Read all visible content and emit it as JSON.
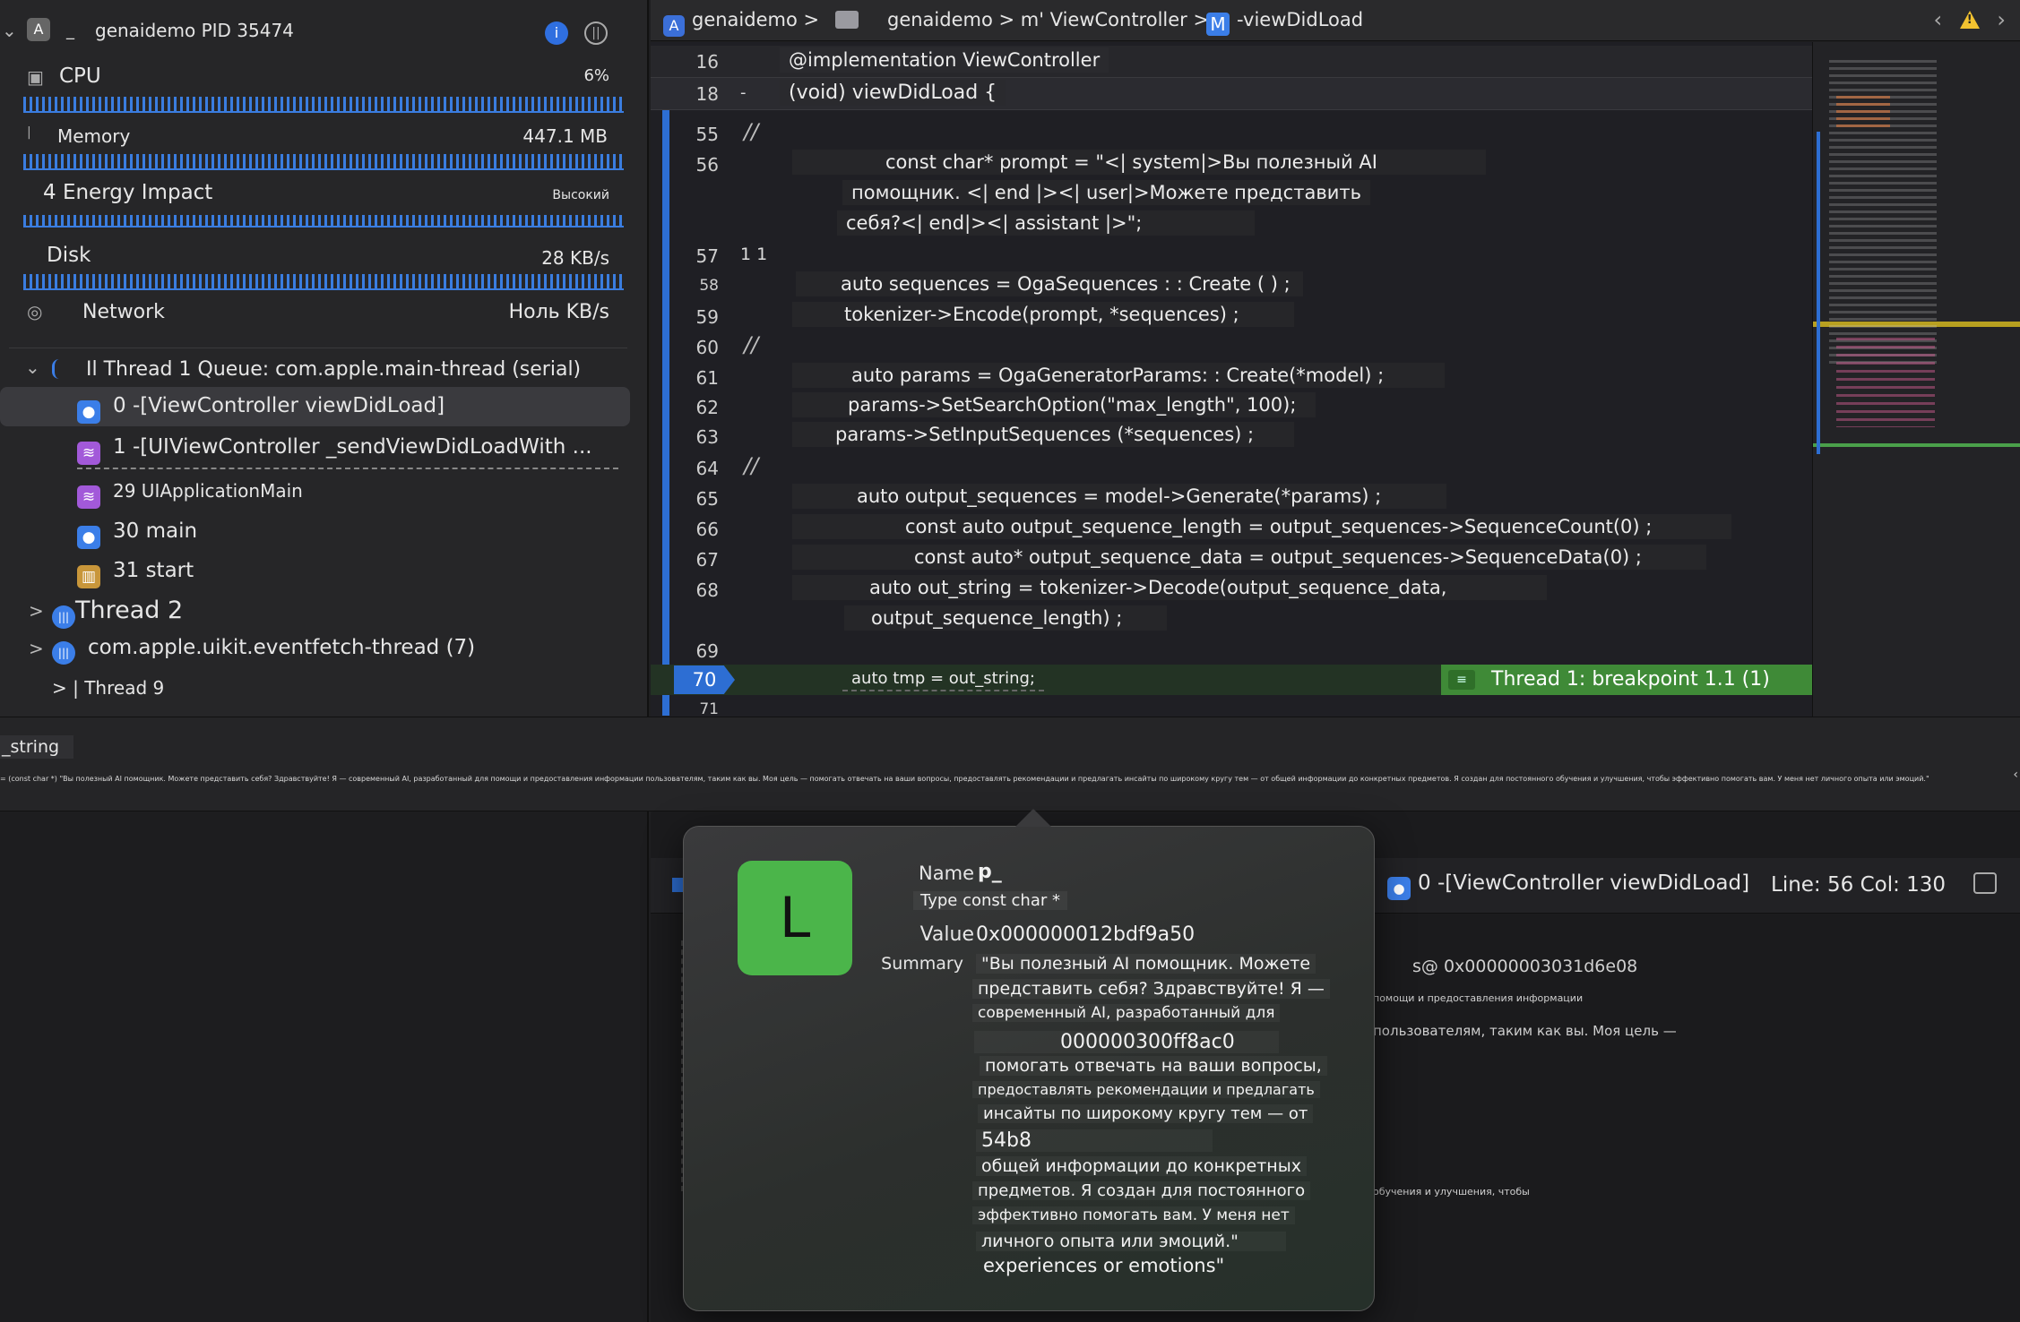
{
  "process": {
    "name": "genaidemo PID 35474"
  },
  "gauges": [
    {
      "label": "CPU",
      "value": "6%"
    },
    {
      "label": "Memory",
      "value": "447.1 MB"
    },
    {
      "label": "4 Energy Impact",
      "value": "Высокий"
    },
    {
      "label": "Disk",
      "value": "28 KB/s"
    },
    {
      "label": "Network",
      "value": "Ноль KB/s"
    }
  ],
  "threads": {
    "thread1": "Il Thread 1 Queue: com.apple.main-thread (serial)",
    "frames": [
      {
        "label": "0 -[ViewController viewDidLoad]"
      },
      {
        "label": "1 -[UIViewController _sendViewDidLoadWith ..."
      },
      {
        "label": "29 UIApplicationMain"
      },
      {
        "label": "30 main"
      },
      {
        "label": "31 start"
      }
    ],
    "thread2": "Thread 2",
    "eventfetch": "com.apple.uikit.eventfetch-thread (7)",
    "thread9": "> | Thread 9"
  },
  "jumpbar": {
    "crumb1": "genaidemo >",
    "crumb2": "genaidemo > m' ViewController >",
    "crumb3": "-viewDidLoad",
    "m_icon": "M"
  },
  "editor": {
    "sticky1": {
      "line": "16",
      "code": "@implementation ViewController"
    },
    "sticky2": {
      "line": "18",
      "marker": "-",
      "code": "(void) viewDidLoad {"
    },
    "lines": [
      {
        "no": "55",
        "comment": "//"
      },
      {
        "no": "56",
        "code": [
          "const char* prompt = \"<| system|>Вы полезный AI",
          "помощник. <| end |><| user|>Можете представить",
          "себя?<| end|><| assistant |>\";"
        ]
      },
      {
        "no": "57",
        "extra": "1 1"
      },
      {
        "no": "58",
        "code": [
          "auto sequences = OgaSequences : : Create ( ) ;"
        ]
      },
      {
        "no": "59",
        "code": [
          "tokenizer->Encode(prompt, *sequences) ;"
        ]
      },
      {
        "no": "60",
        "comment": "//"
      },
      {
        "no": "61",
        "code": [
          "auto params = OgaGeneratorParams: : Create(*model) ;"
        ]
      },
      {
        "no": "62",
        "code": [
          "params->SetSearchOption(\"max_length\", 100);"
        ]
      },
      {
        "no": "63",
        "code": [
          "params->SetInputSequences (*sequences) ;"
        ]
      },
      {
        "no": "64",
        "comment": "//"
      },
      {
        "no": "65",
        "code": [
          "auto output_sequences = model->Generate(*params) ;"
        ]
      },
      {
        "no": "66",
        "code": [
          "const auto output_sequence_length = output_sequences->SequenceCount(0) ;"
        ]
      },
      {
        "no": "67",
        "code": [
          "const auto* output_sequence_data = output_sequences->SequenceData(0) ;"
        ]
      },
      {
        "no": "68",
        "code": [
          "auto out_string = tokenizer->Decode(output_sequence_data,",
          "output_sequence_length) ;"
        ]
      },
      {
        "no": "69"
      },
      {
        "no": "70",
        "code": [
          "auto tmp = out_string;"
        ]
      },
      {
        "no": "71"
      }
    ],
    "breakpoint": "Thread 1: breakpoint 1.1 (1)"
  },
  "variable_strip": {
    "name": "_string",
    "summary": "= (const char *) \"Вы полезный AI помощник. Можете представить себя? Здравствуйте! Я — современный AI, разработанный для помощи и предоставления информации пользователям, таким как вы. Моя цель — помогать отвечать на ваши вопросы, предоставлять рекомендации и предлагать инсайты по широкому кругу тем — от общей информации до конкретных предметов. Я создан для постоянного обучения и улучшения, чтобы эффективно помогать вам. У меня нет личного опыта или эмоций.\""
  },
  "debugbar": {
    "frame": "0 -[ViewController viewDidLoad]",
    "position": "Line: 56 Col: 130"
  },
  "background_text": {
    "addr": "s@ 0x00000003031d6e08",
    "t1": "помощи и предоставления информации",
    "t2": "пользователям, таким как вы. Моя цель —",
    "t3": "обучения и улучшения, чтобы"
  },
  "popover": {
    "icon_letter": "L",
    "name_key": "Name",
    "name_val": "p_",
    "type": "Type const char *",
    "value_key": "Value",
    "value_val": "0x000000012bdf9a50",
    "summary_key": "Summary",
    "summary_lines": [
      "\"Вы полезный AI помощник. Можете",
      "представить себя? Здравствуйте! Я —",
      "современный AI, разработанный для",
      "000000300ff8ac0",
      "помогать отвечать на ваши вопросы,",
      "предоставлять рекомендации и предлагать",
      "инсайты по широкому кругу тем — от",
      "54b8",
      "общей информации до конкретных",
      "предметов. Я создан для постоянного",
      "эффективно помогать вам. У меня нет",
      "личного опыта или эмоций.\"",
      "experiences or emotions\""
    ]
  },
  "colors": {
    "accent": "#3a7de0",
    "breakpoint_green": "#3f8a37",
    "app_icon_green": "#4bb54a"
  }
}
